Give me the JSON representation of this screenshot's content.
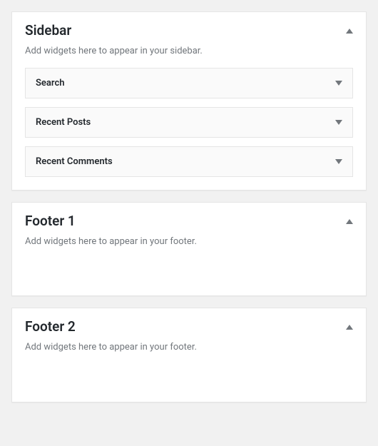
{
  "areas": [
    {
      "title": "Sidebar",
      "description": "Add widgets here to appear in your sidebar.",
      "widgets": [
        {
          "title": "Search"
        },
        {
          "title": "Recent Posts"
        },
        {
          "title": "Recent Comments"
        }
      ]
    },
    {
      "title": "Footer 1",
      "description": "Add widgets here to appear in your footer.",
      "widgets": []
    },
    {
      "title": "Footer 2",
      "description": "Add widgets here to appear in your footer.",
      "widgets": []
    }
  ]
}
